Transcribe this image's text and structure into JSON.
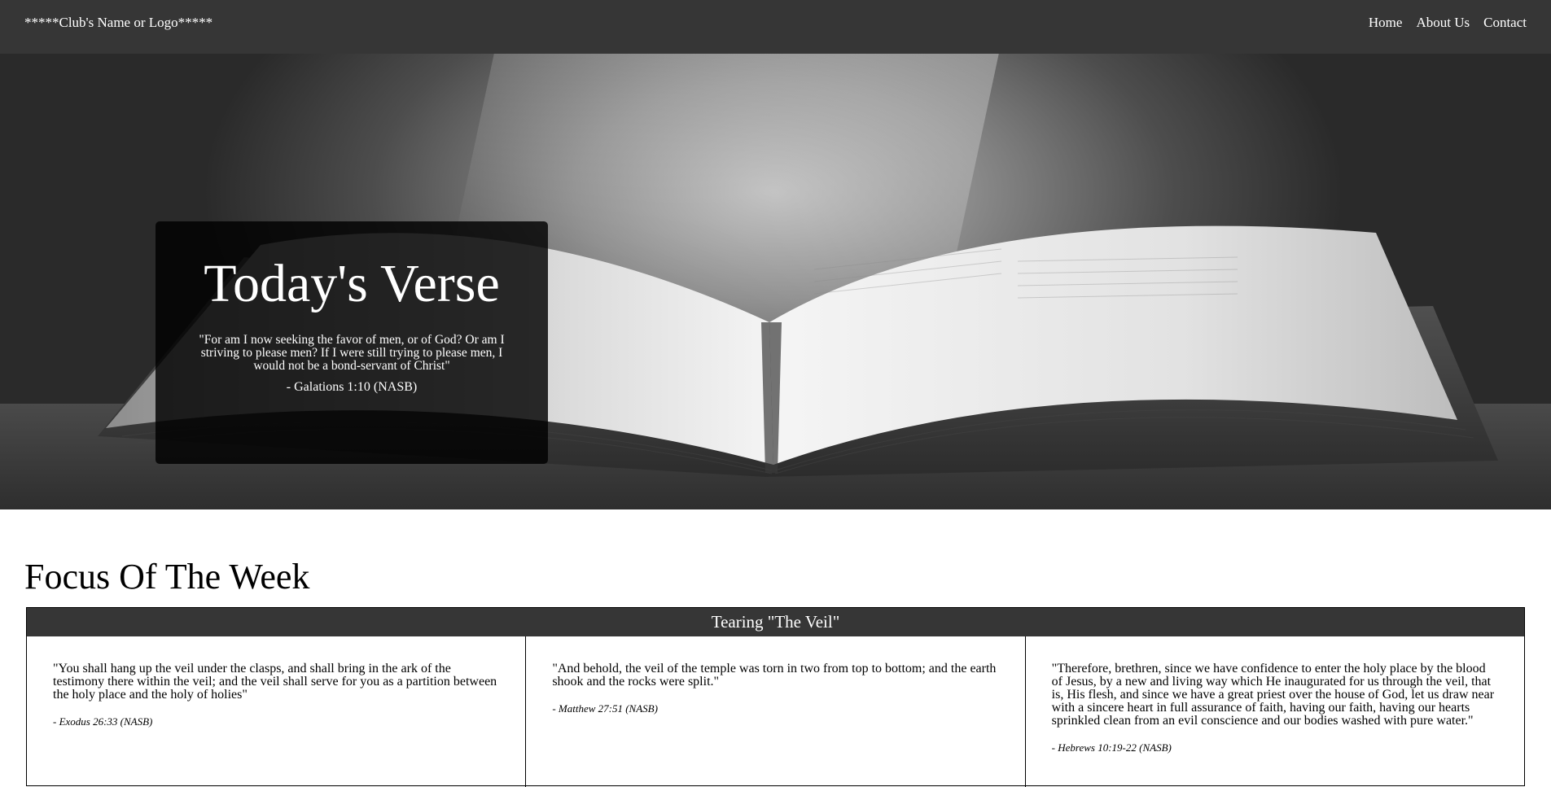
{
  "navbar": {
    "brand": "*****Club's Name or Logo*****",
    "links": [
      "Home",
      "About Us",
      "Contact"
    ],
    "background": "#363636"
  },
  "hero": {
    "image": "open-bible-photo",
    "card": {
      "title": "Today's Verse",
      "text": "\"For am I now seeking the favor of men, or of God? Or am I striving to please men? If I were still trying to please men, I would not be a bond-servant of Christ\"",
      "reference": "- Galations 1:10 (NASB)"
    }
  },
  "focus": {
    "heading": "Focus Of The Week",
    "title": "Tearing \"The Veil\"",
    "columns": [
      {
        "quote": "\"You shall hang up the veil under the clasps, and shall bring in the ark of the testimony there within the veil; and the veil shall serve for you as a partition between the holy place and the holy of holies\"",
        "reference": "- Exodus 26:33 (NASB)"
      },
      {
        "quote": "\"And behold, the veil of the temple was torn in two from top to bottom; and the earth shook and the rocks were split.\"",
        "reference": "- Matthew 27:51 (NASB)"
      },
      {
        "quote": "\"Therefore, brethren, since we have confidence to enter the holy place by the blood of Jesus, by a new and living way which He inaugurated for us through the veil, that is, His flesh, and since we have a great priest over the house of God, let us draw near with a sincere heart in full assurance of faith, having our faith, having our hearts sprinkled clean from an evil conscience and our bodies washed with pure water.\"",
        "reference": "- Hebrews 10:19-22 (NASB)"
      }
    ]
  }
}
